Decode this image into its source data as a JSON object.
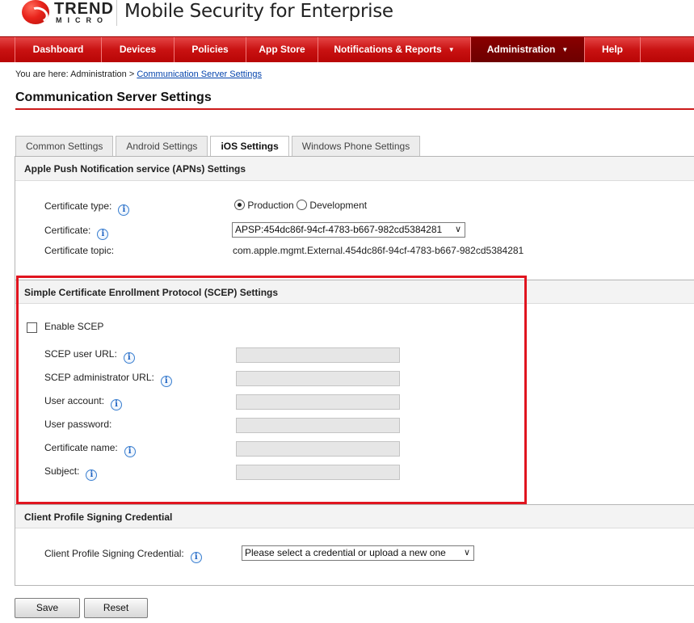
{
  "header": {
    "logo_top": "TREND",
    "logo_bottom": "MICRO",
    "app_title": "Mobile Security for Enterprise"
  },
  "nav": {
    "items": [
      {
        "label": "Dashboard",
        "active": false,
        "dropdown": false
      },
      {
        "label": "Devices",
        "active": false,
        "dropdown": false
      },
      {
        "label": "Policies",
        "active": false,
        "dropdown": false
      },
      {
        "label": "App Store",
        "active": false,
        "dropdown": false
      },
      {
        "label": "Notifications & Reports",
        "active": false,
        "dropdown": true
      },
      {
        "label": "Administration",
        "active": true,
        "dropdown": true
      },
      {
        "label": "Help",
        "active": false,
        "dropdown": false
      }
    ],
    "caret_glyph": "▼",
    "accent_color": "#c91212"
  },
  "breadcrumb": {
    "prefix": "You are here: Administration > ",
    "link": "Communication Server Settings"
  },
  "page_title": "Communication Server Settings",
  "tabs": [
    {
      "label": "Common Settings",
      "active": false
    },
    {
      "label": "Android Settings",
      "active": false
    },
    {
      "label": "iOS Settings",
      "active": true
    },
    {
      "label": "Windows Phone Settings",
      "active": false
    }
  ],
  "apns": {
    "header": "Apple Push Notification service (APNs) Settings",
    "certificate_type_label": "Certificate type:",
    "certificate_type_options": [
      {
        "label": "Production",
        "checked": true
      },
      {
        "label": "Development",
        "checked": false
      }
    ],
    "certificate_label": "Certificate:",
    "certificate_value": "APSP:454dc86f-94cf-4783-b667-982cd5384281",
    "certificate_topic_label": "Certificate topic:",
    "certificate_topic_value": "com.apple.mgmt.External.454dc86f-94cf-4783-b667-982cd5384281"
  },
  "scep": {
    "header": "Simple Certificate Enrollment Protocol (SCEP) Settings",
    "enable_label": "Enable SCEP",
    "enabled": false,
    "fields": [
      {
        "label": "SCEP user URL:",
        "info": true,
        "value": ""
      },
      {
        "label": "SCEP administrator URL:",
        "info": true,
        "value": ""
      },
      {
        "label": "User account:",
        "info": true,
        "value": ""
      },
      {
        "label": "User password:",
        "info": false,
        "value": ""
      },
      {
        "label": "Certificate name:",
        "info": true,
        "value": ""
      },
      {
        "label": "Subject:",
        "info": true,
        "value": ""
      }
    ],
    "highlight_color": "#e0141f"
  },
  "signing": {
    "header": "Client Profile Signing Credential",
    "label": "Client Profile Signing Credential:",
    "select_value": "Please select a credential or upload a new one"
  },
  "icons": {
    "info": "i",
    "chevron_down": "∨"
  },
  "buttons": {
    "save": "Save",
    "reset": "Reset"
  }
}
